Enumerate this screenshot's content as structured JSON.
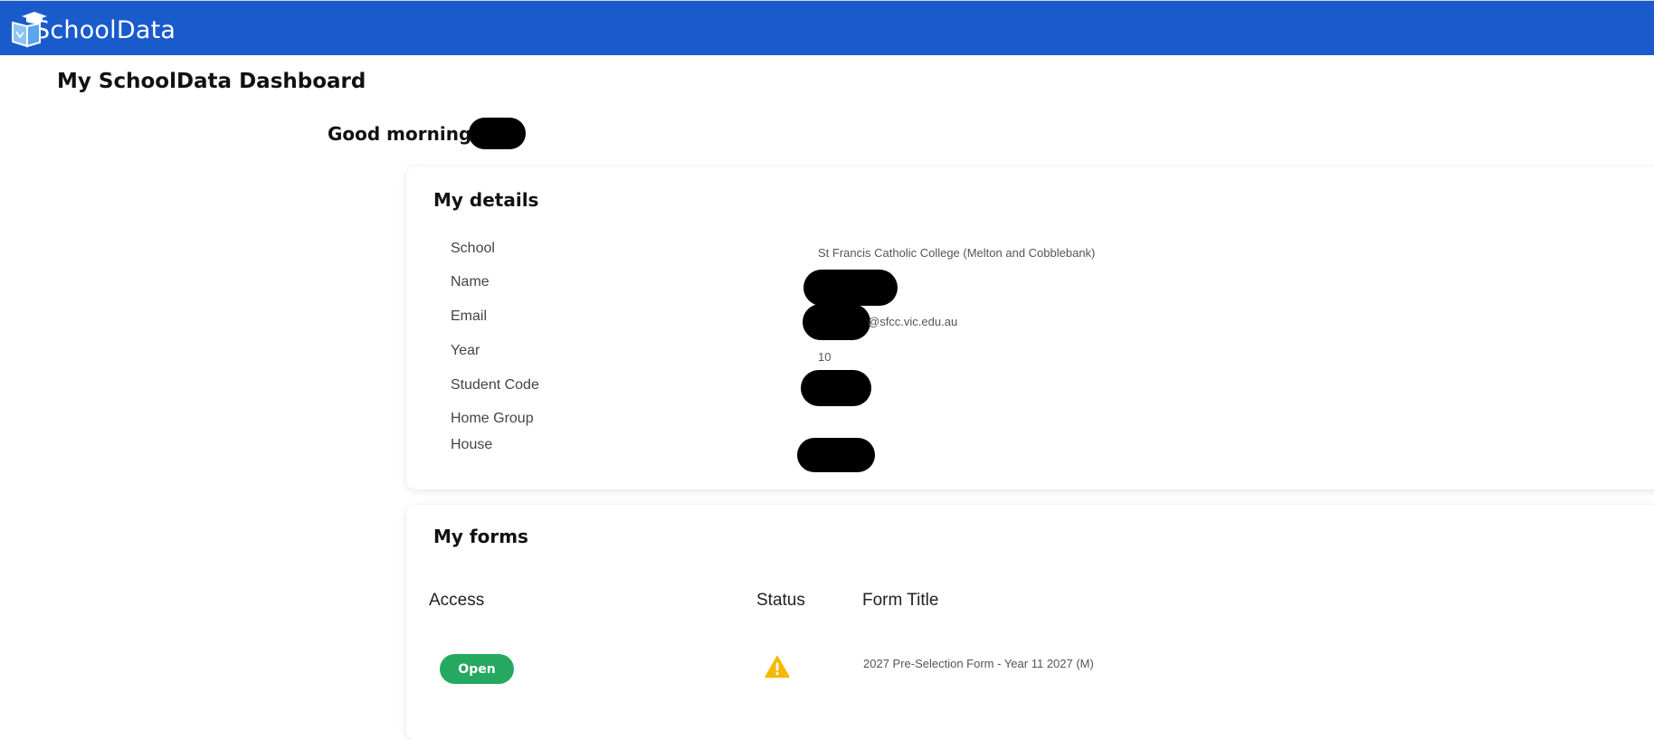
{
  "header": {
    "brand": "SchoolData",
    "logo_icon": "graduation-cap-book-icon",
    "bar_color": "#1a5bcc"
  },
  "page": {
    "title": "My SchoolData Dashboard",
    "greeting": "Good morning"
  },
  "details": {
    "title": "My details",
    "rows": [
      {
        "label": "School",
        "value": "St Francis Catholic College (Melton and Cobblebank)"
      },
      {
        "label": "Name",
        "value": ""
      },
      {
        "label": "Email",
        "value": "@sfcc.vic.edu.au"
      },
      {
        "label": "Year",
        "value": "10"
      },
      {
        "label": "Student Code",
        "value": ""
      },
      {
        "label": "Home Group",
        "value": ""
      },
      {
        "label": "House",
        "value": ""
      }
    ]
  },
  "forms": {
    "title": "My forms",
    "columns": [
      "Access",
      "Status",
      "Form Title"
    ],
    "rows": [
      {
        "access": "Open",
        "status_icon": "warning-icon",
        "form_title": "2027 Pre-Selection Form - Year 11 2027 (M)"
      }
    ],
    "open_color": "#25a85f",
    "warning_color": "#f5b800"
  }
}
